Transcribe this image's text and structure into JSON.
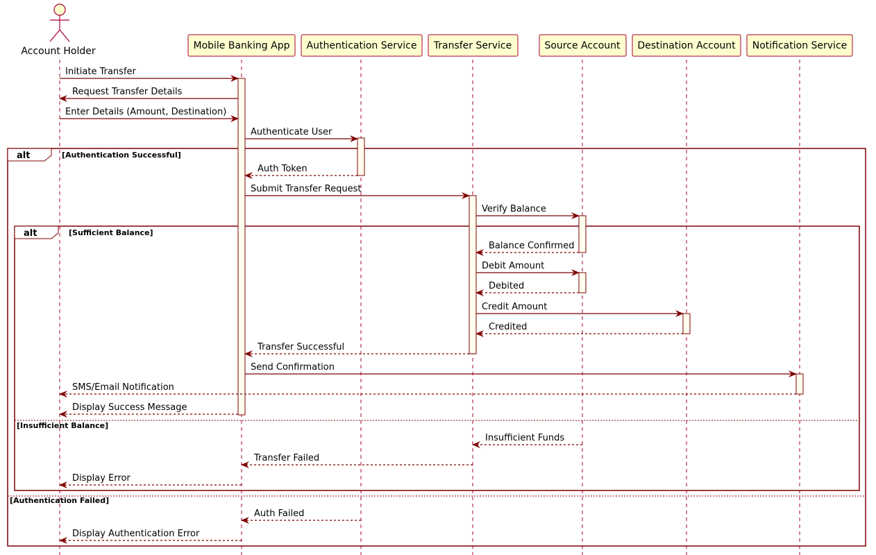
{
  "participants": [
    {
      "id": "user",
      "name": "Account Holder",
      "kind": "actor"
    },
    {
      "id": "app",
      "name": "Mobile Banking App",
      "kind": "box"
    },
    {
      "id": "auth",
      "name": "Authentication Service",
      "kind": "box"
    },
    {
      "id": "transfer",
      "name": "Transfer Service",
      "kind": "box"
    },
    {
      "id": "source",
      "name": "Source Account",
      "kind": "box"
    },
    {
      "id": "dest",
      "name": "Destination Account",
      "kind": "box"
    },
    {
      "id": "notify",
      "name": "Notification Service",
      "kind": "box"
    }
  ],
  "messages": [
    {
      "from": "user",
      "to": "app",
      "label": "Initiate Transfer",
      "style": "solid"
    },
    {
      "from": "app",
      "to": "user",
      "label": "Request Transfer Details",
      "style": "solid"
    },
    {
      "from": "user",
      "to": "app",
      "label": "Enter Details (Amount, Destination)",
      "style": "solid"
    },
    {
      "from": "app",
      "to": "auth",
      "label": "Authenticate User",
      "style": "solid"
    },
    {
      "from": "auth",
      "to": "app",
      "label": "Auth Token",
      "style": "dashed"
    },
    {
      "from": "app",
      "to": "transfer",
      "label": "Submit Transfer Request",
      "style": "solid"
    },
    {
      "from": "transfer",
      "to": "source",
      "label": "Verify Balance",
      "style": "solid"
    },
    {
      "from": "source",
      "to": "transfer",
      "label": "Balance Confirmed",
      "style": "dashed"
    },
    {
      "from": "transfer",
      "to": "source",
      "label": "Debit Amount",
      "style": "solid"
    },
    {
      "from": "source",
      "to": "transfer",
      "label": "Debited",
      "style": "dashed"
    },
    {
      "from": "transfer",
      "to": "dest",
      "label": "Credit Amount",
      "style": "solid"
    },
    {
      "from": "dest",
      "to": "transfer",
      "label": "Credited",
      "style": "dashed"
    },
    {
      "from": "transfer",
      "to": "app",
      "label": "Transfer Successful",
      "style": "dashed"
    },
    {
      "from": "app",
      "to": "notify",
      "label": "Send Confirmation",
      "style": "solid"
    },
    {
      "from": "notify",
      "to": "user",
      "label": "SMS/Email Notification",
      "style": "dashed"
    },
    {
      "from": "app",
      "to": "user",
      "label": "Display Success Message",
      "style": "dashed"
    },
    {
      "from": "source",
      "to": "transfer",
      "label": "Insufficient Funds",
      "style": "dashed"
    },
    {
      "from": "transfer",
      "to": "app",
      "label": "Transfer Failed",
      "style": "dashed"
    },
    {
      "from": "app",
      "to": "user",
      "label": "Display Error",
      "style": "dashed"
    },
    {
      "from": "auth",
      "to": "app",
      "label": "Auth Failed",
      "style": "dashed"
    },
    {
      "from": "app",
      "to": "user",
      "label": "Display Authentication Error",
      "style": "dashed"
    }
  ],
  "fragments": [
    {
      "keyword": "alt",
      "condition": "[Authentication Successful]",
      "else_condition": "[Authentication Failed]"
    },
    {
      "keyword": "alt",
      "condition": "[Sufficient Balance]",
      "else_condition": "[Insufficient Balance]"
    }
  ],
  "colors": {
    "line": "#7f0000",
    "participant_fill": "#fefece",
    "participant_border": "#a80036",
    "activation_fill": "#fffff0",
    "lifeline": "#a80036",
    "fragment_border": "#7f0000"
  }
}
